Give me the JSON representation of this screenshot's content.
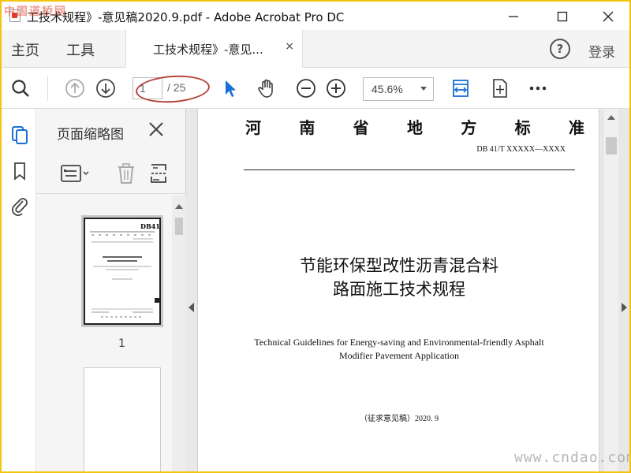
{
  "window": {
    "title": "工技术规程》-意见稿2020.9.pdf - Adobe Acrobat Pro DC"
  },
  "watermarks": {
    "top_left": "中国道桥网",
    "bottom_right": "www.cndao.com"
  },
  "tabs": {
    "home": "主页",
    "tools": "工具",
    "document": "工技术规程》-意见...",
    "close_glyph": "×",
    "help_glyph": "?",
    "signin": "登录"
  },
  "toolbar": {
    "page_current": "1",
    "page_total": "/ 25",
    "zoom": "45.6%",
    "icons": [
      "search-icon",
      "previous-page-icon",
      "next-page-icon",
      "select-pointer-icon",
      "hand-tool-icon",
      "zoom-out-icon",
      "zoom-in-icon",
      "fit-width-icon",
      "scrolling-mode-icon",
      "more-icon"
    ]
  },
  "thumbnails_panel": {
    "title": "页面缩略图",
    "page_number": "1",
    "thumb_header_code": "DB41"
  },
  "document": {
    "header_chars": [
      "河",
      "南",
      "省",
      "地",
      "方",
      "标",
      "准"
    ],
    "code": "DB 41/T  XXXXX—XXXX",
    "title_cn_line1": "节能环保型改性沥青混合料",
    "title_cn_line2": "路面施工技术规程",
    "title_en_line1": "Technical Guidelines for Energy-saving and Environmental-friendly Asphalt",
    "title_en_line2": "Modifier Pavement Application",
    "draft_note": "（征求意见稿）2020. 9"
  }
}
